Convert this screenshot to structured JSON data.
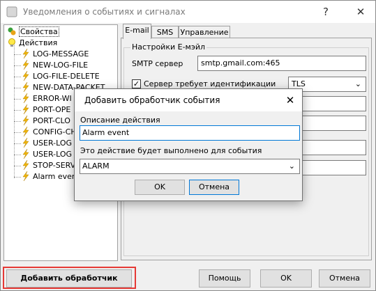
{
  "window": {
    "title": "Уведомления о событиях и сигналах",
    "help_glyph": "?",
    "close_glyph": "✕"
  },
  "tree": {
    "root_items": [
      {
        "label": "Свойства",
        "icon": "properties-icon"
      },
      {
        "label": "Действия",
        "icon": "lightbulb-icon"
      }
    ],
    "actions": [
      "LOG-MESSAGE",
      "NEW-LOG-FILE",
      "LOG-FILE-DELETE",
      "NEW-DATA-PACKET",
      "ERROR-WI",
      "PORT-OPE",
      "PORT-CLO",
      "CONFIG-CH",
      "USER-LOG",
      "USER-LOG",
      "STOP-SERV",
      "Alarm event"
    ]
  },
  "tabs": [
    "E-mail",
    "SMS",
    "Управление"
  ],
  "email": {
    "group_label": "Настройки E-мэйл",
    "smtp_label": "SMTP сервер",
    "smtp_value": "smtp.gmail.com:465",
    "auth_label": "Сервер требует идентификации",
    "auth_checked": true,
    "security_value": "TLS"
  },
  "dialog": {
    "title": "Добавить обработчик события",
    "description_label": "Описание действия",
    "description_value": "Alarm event",
    "event_label": "Это действие будет выполнено для события",
    "event_value": "ALARM",
    "ok_label": "OK",
    "cancel_label": "Отмена",
    "close_glyph": "✕"
  },
  "footer": {
    "add_handler_label": "Добавить обработчик",
    "help_label": "Помощь",
    "ok_label": "OK",
    "cancel_label": "Отмена"
  },
  "colors": {
    "highlight_border": "#e53935",
    "focus_blue": "#0078d7",
    "lightning": "#f2b705"
  }
}
